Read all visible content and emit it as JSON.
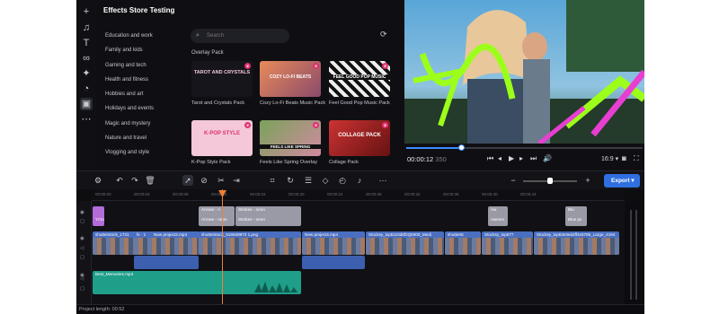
{
  "store": {
    "title": "Effects Store Testing",
    "categories": [
      "Education and work",
      "Family and kids",
      "Gaming and tech",
      "Health and fitness",
      "Hobbies and art",
      "Holidays and events",
      "Magic and mystery",
      "Nature and travel",
      "Vlogging and style"
    ],
    "search_placeholder": "Search",
    "section_title": "Overlay Pack",
    "packs": [
      {
        "label": "Tarot and Crystals Pack",
        "art": "TAROT AND CRYSTALS"
      },
      {
        "label": "Cozy Lo-Fi Beats Music Pack",
        "art": "COZY LO-FI BEATS"
      },
      {
        "label": "Feel Good Pop Music Pack",
        "art": "FEEL GOOD POP MUSIC"
      },
      {
        "label": "K-Pop Style Pack",
        "art": "K-POP STYLE"
      },
      {
        "label": "Feels Like Spring Overlay",
        "art": "FEELS LIKE SPRING"
      },
      {
        "label": "Collage Pack",
        "art": "COLLAGE PACK"
      }
    ]
  },
  "preview": {
    "timecode": "00:00:12",
    "frame": "350",
    "aspect": "16:9",
    "progress": 0.23
  },
  "toolbar": {
    "export_label": "Export"
  },
  "ruler": [
    "00:00:00",
    "00:00:04",
    "00:00:08",
    "00:00:12",
    "00:00:16",
    "00:00:20",
    "00:00:24",
    "00:00:28",
    "00:00:32",
    "00:00:36",
    "00:00:40",
    "00:00:44"
  ],
  "clips": {
    "title_you": "YOU",
    "arrows": "Arrows - n",
    "arrows_sub": "Arrows - neon",
    "strokes": "Strokes - neon",
    "strokes_sub": "Strokes - neon",
    "awesome": "Aw",
    "awesome_sub": "Awesor",
    "blue": "Blu",
    "blue_sub": "Blue px",
    "v1": "shutterstock_1731",
    "v2": "fx · 1",
    "v2b": "New project2.mp4",
    "v3": "shutterstock_516639973 1.png",
    "v4": "New project4.mp4",
    "v5": "Stocksy_txp5110d6f2Q5000_Medi",
    "v6": "shutterst",
    "v7": "Stocksy_txp677",
    "v8": "Stocksy_txp63e3ed4ff4x5786_Large_4194",
    "audio": "Best_Memories.mp3"
  },
  "status": {
    "project_length": "Project length: 00:52"
  }
}
